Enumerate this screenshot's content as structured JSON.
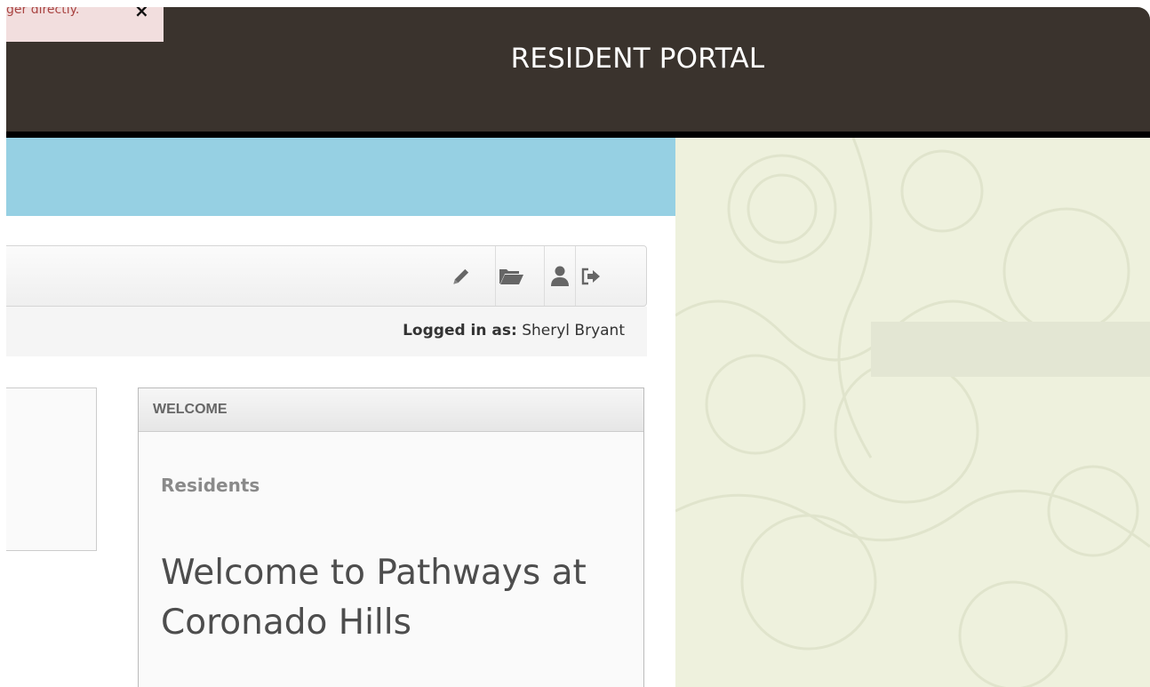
{
  "alert": {
    "text": "ger directly.",
    "close": "×"
  },
  "header": {
    "title": "RESIDENT PORTAL"
  },
  "toolbar": {
    "buttons": [
      {
        "icon": "pencil-icon"
      },
      {
        "icon": "folder-open-icon"
      },
      {
        "icon": "user-icon"
      },
      {
        "icon": "sign-out-icon"
      }
    ]
  },
  "status": {
    "logged_in_label": "Logged in as:",
    "user_name": "Sheryl Bryant"
  },
  "welcome_panel": {
    "heading": "WELCOME",
    "subheading": "Residents",
    "title": "Welcome to Pathways at Coronado Hills"
  },
  "colors": {
    "header_bg": "#3a332d",
    "blue_band": "#96d0e3",
    "pattern_bg": "#eef1dd",
    "alert_bg": "#f2dede"
  }
}
